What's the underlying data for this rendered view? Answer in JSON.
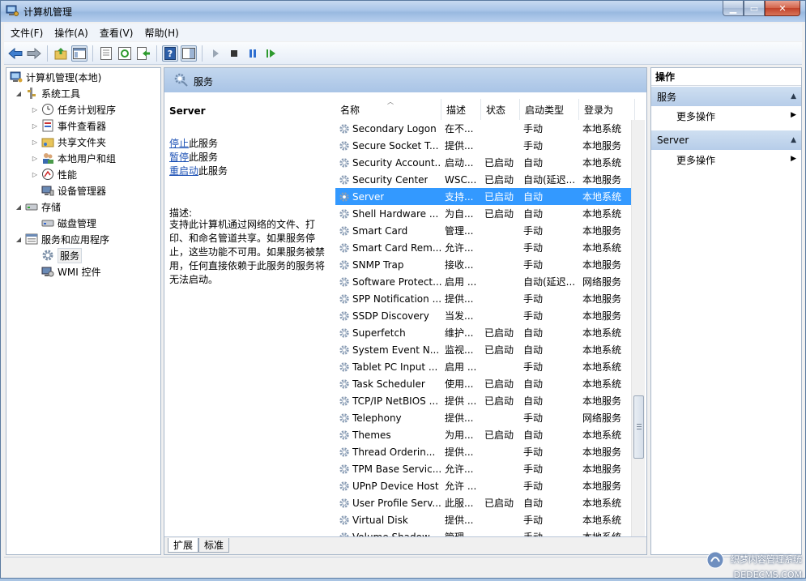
{
  "window": {
    "title": "计算机管理"
  },
  "menu": [
    "文件(F)",
    "操作(A)",
    "查看(V)",
    "帮助(H)"
  ],
  "tree": {
    "root": "计算机管理(本地)",
    "system_tools": "系统工具",
    "task_scheduler": "任务计划程序",
    "event_viewer": "事件查看器",
    "shared_folders": "共享文件夹",
    "local_users": "本地用户和组",
    "performance": "性能",
    "device_manager": "设备管理器",
    "storage": "存储",
    "disk_management": "磁盘管理",
    "services_apps": "服务和应用程序",
    "services": "服务",
    "wmi": "WMI 控件"
  },
  "panel": {
    "title": "服务"
  },
  "detail": {
    "name": "Server",
    "stop_link": "停止",
    "stop_suffix": "此服务",
    "pause_link": "暂停",
    "pause_suffix": "此服务",
    "restart_link": "重启动",
    "restart_suffix": "此服务",
    "desc_label": "描述:",
    "desc_text": "支持此计算机通过网络的文件、打印、和命名管道共享。如果服务停止，这些功能不可用。如果服务被禁用，任何直接依赖于此服务的服务将无法启动。"
  },
  "columns": [
    "名称",
    "描述",
    "状态",
    "启动类型",
    "登录为"
  ],
  "services": [
    [
      "Secondary Logon",
      "在不...",
      "",
      "手动",
      "本地系统"
    ],
    [
      "Secure Socket T...",
      "提供...",
      "",
      "手动",
      "本地服务"
    ],
    [
      "Security Account...",
      "启动...",
      "已启动",
      "自动",
      "本地系统"
    ],
    [
      "Security Center",
      "WSC...",
      "已启动",
      "自动(延迟...",
      "本地服务"
    ],
    [
      "Server",
      "支持...",
      "已启动",
      "自动",
      "本地系统"
    ],
    [
      "Shell Hardware ...",
      "为自...",
      "已启动",
      "自动",
      "本地系统"
    ],
    [
      "Smart Card",
      "管理...",
      "",
      "手动",
      "本地服务"
    ],
    [
      "Smart Card Rem...",
      "允许...",
      "",
      "手动",
      "本地系统"
    ],
    [
      "SNMP Trap",
      "接收...",
      "",
      "手动",
      "本地服务"
    ],
    [
      "Software Protect...",
      "启用 ...",
      "",
      "自动(延迟...",
      "网络服务"
    ],
    [
      "SPP Notification ...",
      "提供...",
      "",
      "手动",
      "本地服务"
    ],
    [
      "SSDP Discovery",
      "当发...",
      "",
      "手动",
      "本地服务"
    ],
    [
      "Superfetch",
      "维护...",
      "已启动",
      "自动",
      "本地系统"
    ],
    [
      "System Event N...",
      "监视...",
      "已启动",
      "自动",
      "本地系统"
    ],
    [
      "Tablet PC Input ...",
      "启用 ...",
      "",
      "手动",
      "本地系统"
    ],
    [
      "Task Scheduler",
      "使用...",
      "已启动",
      "自动",
      "本地系统"
    ],
    [
      "TCP/IP NetBIOS ...",
      "提供 ...",
      "已启动",
      "自动",
      "本地服务"
    ],
    [
      "Telephony",
      "提供...",
      "",
      "手动",
      "网络服务"
    ],
    [
      "Themes",
      "为用...",
      "已启动",
      "自动",
      "本地系统"
    ],
    [
      "Thread Orderin...",
      "提供...",
      "",
      "手动",
      "本地服务"
    ],
    [
      "TPM Base Servic...",
      "允许...",
      "",
      "手动",
      "本地服务"
    ],
    [
      "UPnP Device Host",
      "允许 ...",
      "",
      "手动",
      "本地服务"
    ],
    [
      "User Profile Serv...",
      "此服...",
      "已启动",
      "自动",
      "本地系统"
    ],
    [
      "Virtual Disk",
      "提供...",
      "",
      "手动",
      "本地系统"
    ],
    [
      "Volume Shadow ...",
      "管理...",
      "",
      "手动",
      "本地系统"
    ]
  ],
  "selected_service": "Server",
  "tabs": [
    "扩展",
    "标准"
  ],
  "actions": {
    "title": "操作",
    "section1": "服务",
    "section1_more": "更多操作",
    "section2": "Server",
    "section2_more": "更多操作"
  },
  "watermark": {
    "line1": "织梦内容管理系统",
    "line2": "DEDECMS.COM"
  },
  "colors": {
    "selection": "#3399ff",
    "link": "#1a4fb4",
    "header": "#a9c4e6"
  }
}
